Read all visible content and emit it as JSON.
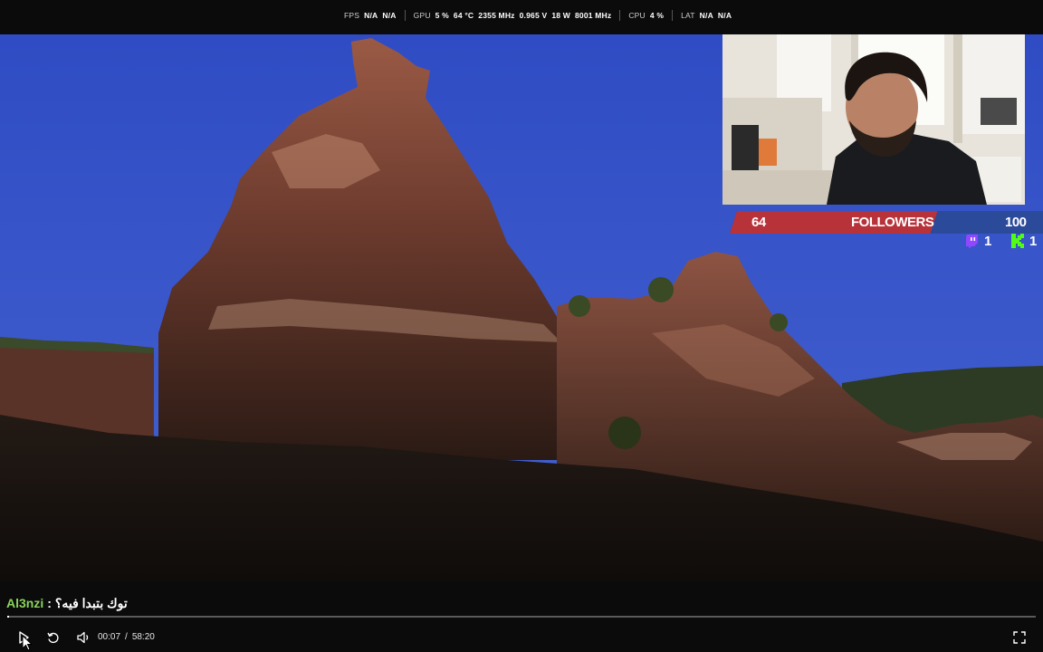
{
  "perf": {
    "fps_label": "FPS",
    "fps_val1": "N/A",
    "fps_val2": "N/A",
    "gpu_label": "GPU",
    "gpu_load": "5 %",
    "gpu_temp": "64 °C",
    "gpu_clock": "2355 MHz",
    "gpu_voltage": "0.965 V",
    "gpu_power": "18 W",
    "gpu_mem": "8001 MHz",
    "cpu_label": "CPU",
    "cpu_load": "4 %",
    "lat_label": "LAT",
    "lat_val1": "N/A",
    "lat_val2": "N/A"
  },
  "followers": {
    "current": "64",
    "label": "FOLLOWERS",
    "goal": "100",
    "goal_fraction": 0.64,
    "twitch_count": "1",
    "kick_count": "1"
  },
  "chat": {
    "user": "Al3nzi",
    "separator": ":",
    "message": "توك بتبدا فيه؟"
  },
  "player": {
    "current_time": "00:07",
    "duration": "58:20",
    "progress_fraction": 0.002
  },
  "icons": {
    "play": "play-icon",
    "replay": "replay-icon",
    "volume": "volume-icon",
    "fullscreen": "fullscreen-icon",
    "twitch": "twitch-icon",
    "kick": "kick-icon"
  },
  "colors": {
    "sky": "#3c55c4",
    "rock": "#6e3a2c",
    "followers_red": "#b8323a",
    "followers_blue": "#2c4a9a",
    "chat_user": "#8ad35b",
    "twitch": "#9146ff",
    "kick": "#53fc18"
  }
}
